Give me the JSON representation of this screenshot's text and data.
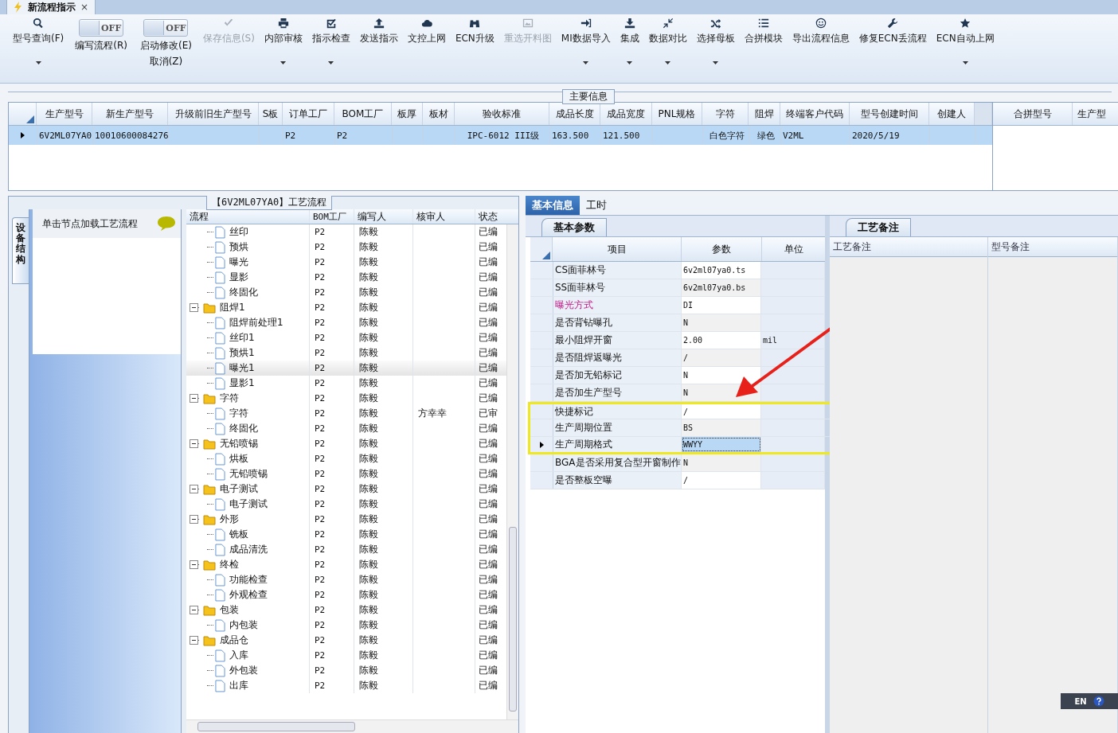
{
  "window": {
    "title": "新流程指示",
    "close": "×"
  },
  "toolbar": [
    {
      "kind": "button",
      "label": "型号查询(F)",
      "dropdown": true,
      "disabled": false
    },
    {
      "kind": "toggle",
      "label": "编写流程(R)",
      "state": "OFF",
      "on": false
    },
    {
      "kind": "toggle",
      "label": "启动修改(E)",
      "sublabel": "取消(Z)",
      "state": "OFF",
      "on": false
    },
    {
      "kind": "button",
      "label": "保存信息(S)",
      "dropdown": false,
      "disabled": true
    },
    {
      "kind": "button",
      "label": "内部审核",
      "dropdown": true,
      "disabled": false
    },
    {
      "kind": "button",
      "label": "指示检查",
      "dropdown": true,
      "disabled": false
    },
    {
      "kind": "button",
      "label": "发送指示",
      "dropdown": false,
      "disabled": false
    },
    {
      "kind": "button",
      "label": "文控上网",
      "dropdown": false,
      "disabled": false
    },
    {
      "kind": "button",
      "label": "ECN升级",
      "dropdown": false,
      "disabled": false
    },
    {
      "kind": "button",
      "label": "重选开料图",
      "dropdown": false,
      "disabled": true
    },
    {
      "kind": "button",
      "label": "MI数据导入",
      "dropdown": true,
      "disabled": false
    },
    {
      "kind": "button",
      "label": "集成",
      "dropdown": true,
      "disabled": false
    },
    {
      "kind": "button",
      "label": "数据对比",
      "dropdown": true,
      "disabled": false
    },
    {
      "kind": "button",
      "label": "选择母板",
      "dropdown": true,
      "disabled": false
    },
    {
      "kind": "button",
      "label": "合拼模块",
      "dropdown": false,
      "disabled": false
    },
    {
      "kind": "button",
      "label": "导出流程信息",
      "dropdown": false,
      "disabled": false
    },
    {
      "kind": "button",
      "label": "修复ECN丢流程",
      "dropdown": false,
      "disabled": false
    },
    {
      "kind": "button",
      "label": "ECN自动上网",
      "dropdown": true,
      "disabled": false
    }
  ],
  "main_info": {
    "title": "主要信息",
    "columns": [
      "生产型号",
      "新生产型号",
      "升级前旧生产型号",
      "S板",
      "订单工厂",
      "BOM工厂",
      "板厚",
      "板材",
      "验收标准",
      "成品长度",
      "成品宽度",
      "PNL规格",
      "字符",
      "阻焊",
      "终端客户代码",
      "型号创建时间",
      "创建人"
    ],
    "rows": [
      {
        "selected": true,
        "cells": [
          "6V2ML07YA0",
          "10010600084276",
          null,
          null,
          "P2",
          "P2",
          null,
          null,
          "IPC-6012 III级",
          "163.500",
          "121.500",
          null,
          "白色字符",
          "绿色",
          "V2ML",
          "2020/5/19",
          null
        ]
      }
    ],
    "side_columns": [
      "合拼型号",
      "生产型"
    ]
  },
  "side_tab": {
    "label": "设备结构"
  },
  "node_panel": {
    "hint": "单击节点加载工艺流程"
  },
  "flow": {
    "title": "【6V2ML07YA0】工艺流程",
    "columns": [
      "流程",
      "BOM工厂",
      "编写人",
      "核审人",
      "状态"
    ],
    "nodes": [
      {
        "children": [
          {
            "label": "丝印",
            "bom": "P2",
            "writer": "陈毅",
            "status": "已编",
            "selected": false
          },
          {
            "label": "预烘",
            "bom": "P2",
            "writer": "陈毅",
            "status": "已编",
            "selected": false
          },
          {
            "label": "曝光",
            "bom": "P2",
            "writer": "陈毅",
            "status": "已编",
            "selected": false
          },
          {
            "label": "显影",
            "bom": "P2",
            "writer": "陈毅",
            "status": "已编",
            "selected": false
          },
          {
            "label": "终固化",
            "bom": "P2",
            "writer": "陈毅",
            "status": "已编",
            "selected": false
          }
        ]
      },
      {
        "label": "阻焊1",
        "bom": "P2",
        "writer": "陈毅",
        "status": "已编",
        "selected": false,
        "expanded": true,
        "children": [
          {
            "label": "阻焊前处理1",
            "bom": "P2",
            "writer": "陈毅",
            "status": "已编",
            "selected": false
          },
          {
            "label": "丝印1",
            "bom": "P2",
            "writer": "陈毅",
            "status": "已编",
            "selected": false
          },
          {
            "label": "预烘1",
            "bom": "P2",
            "writer": "陈毅",
            "status": "已编",
            "selected": false
          },
          {
            "label": "曝光1",
            "bom": "P2",
            "writer": "陈毅",
            "status": "已编",
            "selected": true
          },
          {
            "label": "显影1",
            "bom": "P2",
            "writer": "陈毅",
            "status": "已编",
            "selected": false
          }
        ]
      },
      {
        "label": "字符",
        "bom": "P2",
        "writer": "陈毅",
        "status": "已编",
        "selected": false,
        "expanded": true,
        "children": [
          {
            "label": "字符",
            "bom": "P2",
            "writer": "陈毅",
            "reviewer": "方幸幸",
            "status": "已审",
            "selected": false
          },
          {
            "label": "终固化",
            "bom": "P2",
            "writer": "陈毅",
            "status": "已编",
            "selected": false
          }
        ]
      },
      {
        "label": "无铅喷锡",
        "bom": "P2",
        "writer": "陈毅",
        "status": "已编",
        "selected": false,
        "expanded": true,
        "children": [
          {
            "label": "烘板",
            "bom": "P2",
            "writer": "陈毅",
            "status": "已编",
            "selected": false
          },
          {
            "label": "无铅喷锡",
            "bom": "P2",
            "writer": "陈毅",
            "status": "已编",
            "selected": false
          }
        ]
      },
      {
        "label": "电子测试",
        "bom": "P2",
        "writer": "陈毅",
        "status": "已编",
        "selected": false,
        "expanded": true,
        "children": [
          {
            "label": "电子测试",
            "bom": "P2",
            "writer": "陈毅",
            "status": "已编",
            "selected": false
          }
        ]
      },
      {
        "label": "外形",
        "bom": "P2",
        "writer": "陈毅",
        "status": "已编",
        "selected": false,
        "expanded": true,
        "children": [
          {
            "label": "铣板",
            "bom": "P2",
            "writer": "陈毅",
            "status": "已编",
            "selected": false
          },
          {
            "label": "成品清洗",
            "bom": "P2",
            "writer": "陈毅",
            "status": "已编",
            "selected": false
          }
        ]
      },
      {
        "label": "终检",
        "bom": "P2",
        "writer": "陈毅",
        "status": "已编",
        "selected": false,
        "expanded": true,
        "children": [
          {
            "label": "功能检查",
            "bom": "P2",
            "writer": "陈毅",
            "status": "已编",
            "selected": false
          },
          {
            "label": "外观检查",
            "bom": "P2",
            "writer": "陈毅",
            "status": "已编",
            "selected": false
          }
        ]
      },
      {
        "label": "包装",
        "bom": "P2",
        "writer": "陈毅",
        "status": "已编",
        "selected": false,
        "expanded": true,
        "children": [
          {
            "label": "内包装",
            "bom": "P2",
            "writer": "陈毅",
            "status": "已编",
            "selected": false
          }
        ]
      },
      {
        "label": "成品仓",
        "bom": "P2",
        "writer": "陈毅",
        "status": "已编",
        "selected": false,
        "expanded": true,
        "children": [
          {
            "label": "入库",
            "bom": "P2",
            "writer": "陈毅",
            "status": "已编",
            "selected": false
          },
          {
            "label": "外包装",
            "bom": "P2",
            "writer": "陈毅",
            "status": "已编",
            "selected": false
          },
          {
            "label": "出库",
            "bom": "P2",
            "writer": "陈毅",
            "status": "已编",
            "selected": false
          }
        ]
      }
    ]
  },
  "info_tabs": [
    {
      "label": "基本信息",
      "selected": true
    },
    {
      "label": "工时",
      "selected": false
    }
  ],
  "params": {
    "tab": "基本参数",
    "columns": [
      "项目",
      "参数",
      "单位"
    ],
    "rows": [
      {
        "item": "CS面菲林号",
        "value": "6v2ml07ya0.ts",
        "flagged": false,
        "selected": false,
        "marked": false
      },
      {
        "item": "SS面菲林号",
        "value": "6v2ml07ya0.bs",
        "flagged": false,
        "selected": false,
        "marked": false
      },
      {
        "item": "曝光方式",
        "value": "DI",
        "flagged": true,
        "selected": false,
        "marked": false
      },
      {
        "item": "是否背钻曝孔",
        "value": "N",
        "flagged": false,
        "selected": false,
        "marked": false
      },
      {
        "item": "最小阻焊开窗",
        "value": "2.00",
        "unit": "mil",
        "flagged": false,
        "selected": false,
        "marked": false
      },
      {
        "item": "是否阻焊返曝光",
        "value": "/",
        "flagged": false,
        "selected": false,
        "marked": false
      },
      {
        "item": "是否加无铅标记",
        "value": "N",
        "flagged": false,
        "selected": false,
        "marked": false
      },
      {
        "item": "是否加生产型号",
        "value": "N",
        "flagged": false,
        "selected": false,
        "marked": false
      },
      {
        "item": "快捷标记",
        "value": "/",
        "flagged": false,
        "selected": false,
        "marked": true
      },
      {
        "item": "生产周期位置",
        "value": "BS",
        "flagged": false,
        "selected": false,
        "marked": true
      },
      {
        "item": "生产周期格式",
        "value": "WWYY",
        "flagged": false,
        "selected": true,
        "marked": true
      },
      {
        "item": "BGA是否采用复合型开窗制作",
        "value": "N",
        "flagged": false,
        "selected": false,
        "marked": false
      },
      {
        "item": "是否整板空曝",
        "value": "/",
        "flagged": false,
        "selected": false,
        "marked": false
      }
    ]
  },
  "notes": {
    "tab": "工艺备注",
    "columns": [
      "工艺备注",
      "型号备注"
    ]
  },
  "language_bar": {
    "language": "EN"
  }
}
